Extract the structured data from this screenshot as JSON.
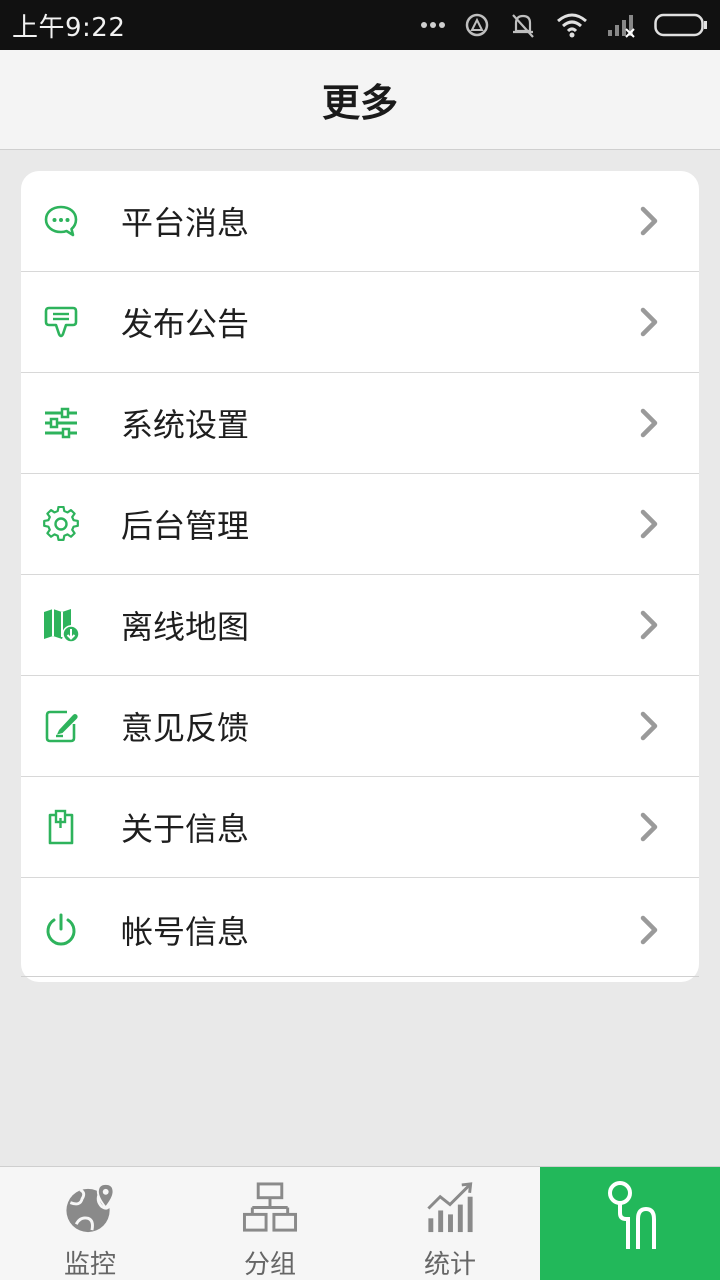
{
  "status_bar": {
    "time": "上午9:22"
  },
  "header": {
    "title": "更多"
  },
  "menu": {
    "items": [
      {
        "label": "平台消息",
        "icon": "chat-bubble-icon"
      },
      {
        "label": "发布公告",
        "icon": "announcement-icon"
      },
      {
        "label": "系统设置",
        "icon": "sliders-icon"
      },
      {
        "label": "后台管理",
        "icon": "gear-icon"
      },
      {
        "label": "离线地图",
        "icon": "offline-map-icon"
      },
      {
        "label": "意见反馈",
        "icon": "feedback-edit-icon"
      },
      {
        "label": "关于信息",
        "icon": "clipboard-icon"
      },
      {
        "label": "帐号信息",
        "icon": "power-icon"
      }
    ]
  },
  "tabbar": {
    "tabs": [
      {
        "label": "监控",
        "icon": "globe-pin-icon",
        "active": false
      },
      {
        "label": "分组",
        "icon": "hierarchy-icon",
        "active": false
      },
      {
        "label": "统计",
        "icon": "bar-chart-trend-icon",
        "active": false
      },
      {
        "label": "",
        "icon": "more-active-icon",
        "active": true
      }
    ]
  },
  "colors": {
    "accent": "#22b85a",
    "icon_green": "#2eb35c",
    "background": "#e9e9e9",
    "status_bar": "#111111"
  }
}
